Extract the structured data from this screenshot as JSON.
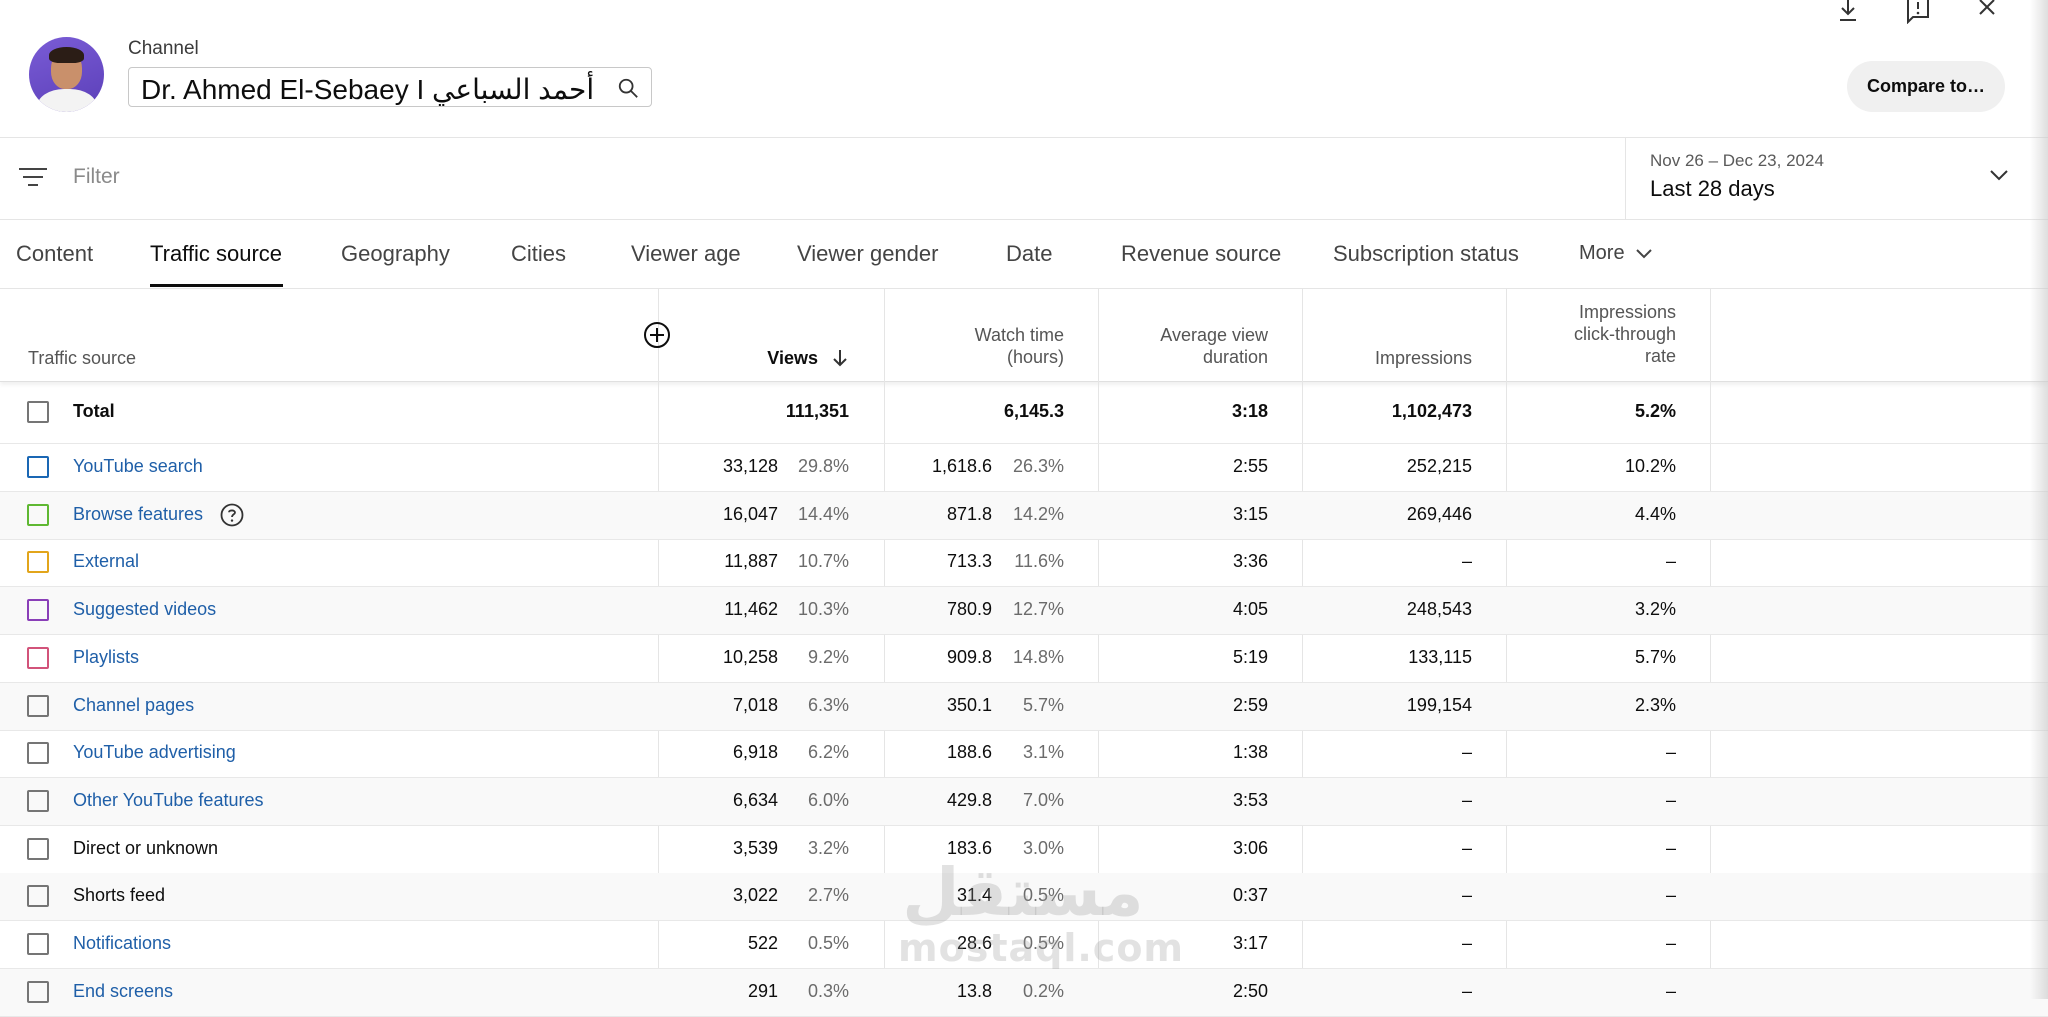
{
  "header": {
    "channel_label": "Channel",
    "channel_name": "Dr. Ahmed El-Sebaey I أحمد السباعي",
    "compare_label": "Compare to…"
  },
  "filter": {
    "placeholder": "Filter",
    "date_range": "Nov 26 – Dec 23, 2024",
    "date_label": "Last 28 days"
  },
  "tabs": [
    {
      "label": "Content"
    },
    {
      "label": "Traffic source"
    },
    {
      "label": "Geography"
    },
    {
      "label": "Cities"
    },
    {
      "label": "Viewer age"
    },
    {
      "label": "Viewer gender"
    },
    {
      "label": "Date"
    },
    {
      "label": "Revenue source"
    },
    {
      "label": "Subscription status"
    },
    {
      "label": "More"
    }
  ],
  "table": {
    "columns": {
      "source": "Traffic source",
      "views": "Views",
      "watch_time_1": "Watch time",
      "watch_time_2": "(hours)",
      "avd_1": "Average view",
      "avd_2": "duration",
      "impressions": "Impressions",
      "ctr_1": "Impressions",
      "ctr_2": "click-through",
      "ctr_3": "rate"
    },
    "total": {
      "label": "Total",
      "views": "111,351",
      "watch_time": "6,145.3",
      "avd": "3:18",
      "impressions": "1,102,473",
      "ctr": "5.2%"
    },
    "rows": [
      {
        "name": "YouTube search",
        "views": "33,128",
        "views_pct": "29.8%",
        "watch": "1,618.6",
        "watch_pct": "26.3%",
        "avd": "2:55",
        "impressions": "252,215",
        "ctr": "10.2%",
        "color": "#1a67b4",
        "link": true
      },
      {
        "name": "Browse features",
        "views": "16,047",
        "views_pct": "14.4%",
        "watch": "871.8",
        "watch_pct": "14.2%",
        "avd": "3:15",
        "impressions": "269,446",
        "ctr": "4.4%",
        "color": "#5fb832",
        "link": true
      },
      {
        "name": "External",
        "views": "11,887",
        "views_pct": "10.7%",
        "watch": "713.3",
        "watch_pct": "11.6%",
        "avd": "3:36",
        "impressions": "–",
        "ctr": "–",
        "color": "#e2a51b",
        "link": true
      },
      {
        "name": "Suggested videos",
        "views": "11,462",
        "views_pct": "10.3%",
        "watch": "780.9",
        "watch_pct": "12.7%",
        "avd": "4:05",
        "impressions": "248,543",
        "ctr": "3.2%",
        "color": "#8a3fb8",
        "link": true
      },
      {
        "name": "Playlists",
        "views": "10,258",
        "views_pct": "9.2%",
        "watch": "909.8",
        "watch_pct": "14.8%",
        "avd": "5:19",
        "impressions": "133,115",
        "ctr": "5.7%",
        "color": "#d2537a",
        "link": true
      },
      {
        "name": "Channel pages",
        "views": "7,018",
        "views_pct": "6.3%",
        "watch": "350.1",
        "watch_pct": "5.7%",
        "avd": "2:59",
        "impressions": "199,154",
        "ctr": "2.3%",
        "color": "#757575",
        "link": true
      },
      {
        "name": "YouTube advertising",
        "views": "6,918",
        "views_pct": "6.2%",
        "watch": "188.6",
        "watch_pct": "3.1%",
        "avd": "1:38",
        "impressions": "–",
        "ctr": "–",
        "color": "#757575",
        "link": true
      },
      {
        "name": "Other YouTube features",
        "views": "6,634",
        "views_pct": "6.0%",
        "watch": "429.8",
        "watch_pct": "7.0%",
        "avd": "3:53",
        "impressions": "–",
        "ctr": "–",
        "color": "#757575",
        "link": true
      },
      {
        "name": "Direct or unknown",
        "views": "3,539",
        "views_pct": "3.2%",
        "watch": "183.6",
        "watch_pct": "3.0%",
        "avd": "3:06",
        "impressions": "–",
        "ctr": "–",
        "color": "#757575",
        "link": false
      },
      {
        "name": "Shorts feed",
        "views": "3,022",
        "views_pct": "2.7%",
        "watch": "31.4",
        "watch_pct": "0.5%",
        "avd": "0:37",
        "impressions": "–",
        "ctr": "–",
        "color": "#757575",
        "link": false
      },
      {
        "name": "Notifications",
        "views": "522",
        "views_pct": "0.5%",
        "watch": "28.6",
        "watch_pct": "0.5%",
        "avd": "3:17",
        "impressions": "–",
        "ctr": "–",
        "color": "#757575",
        "link": true
      },
      {
        "name": "End screens",
        "views": "291",
        "views_pct": "0.3%",
        "watch": "13.8",
        "watch_pct": "0.2%",
        "avd": "2:50",
        "impressions": "–",
        "ctr": "–",
        "color": "#757575",
        "link": true
      }
    ]
  },
  "watermark": {
    "arabic": "مستقل",
    "latin": "mostaql.com"
  },
  "icons": {
    "download": "download-icon",
    "feedback": "feedback-icon",
    "close": "close-icon",
    "search": "search-icon",
    "filter": "filter-lines-icon",
    "chevron": "chevron-down-icon",
    "add_column": "add-circle-icon",
    "sort": "arrow-down-icon",
    "help": "help-circle-icon"
  }
}
